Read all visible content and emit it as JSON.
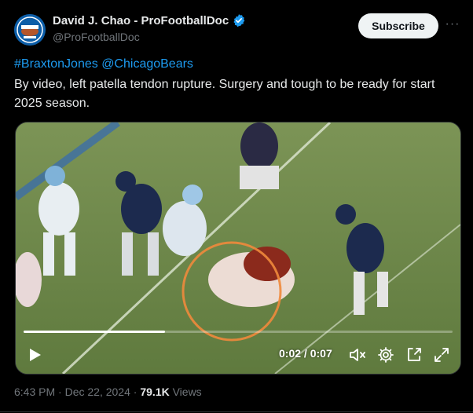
{
  "author": {
    "display_name": "David J. Chao - ProFootballDoc",
    "handle": "@ProFootballDoc",
    "avatar_icon": "profootballdoc-logo-icon",
    "verified_icon": "verified-badge-icon",
    "verified_color": "#1d9bf0"
  },
  "actions": {
    "subscribe_label": "Subscribe",
    "more_icon": "more-options-icon",
    "more_label": "···"
  },
  "post": {
    "hashtag": "#BraxtonJones",
    "mention": "@ChicagoBears",
    "text": "By video, left patella tendon rupture. Surgery and tough to be ready for start 2025 season."
  },
  "video": {
    "current_time": "0:02",
    "separator": " / ",
    "duration": "0:07",
    "progress_fraction": 0.33,
    "controls": [
      "play-icon",
      "mute-icon",
      "settings-icon",
      "pop-out-icon",
      "fullscreen-icon"
    ]
  },
  "meta": {
    "time": "6:43 PM",
    "dot1": " · ",
    "date": "Dec 22, 2024",
    "dot2": " · ",
    "views_count": "79.1K",
    "views_label": " Views"
  },
  "colors": {
    "background": "#000000",
    "link": "#1d9bf0",
    "secondary_text": "#71767b",
    "primary_text": "#e7e9ea",
    "subscribe_bg": "#eff3f4",
    "highlight_circle": "#f08a3c"
  }
}
